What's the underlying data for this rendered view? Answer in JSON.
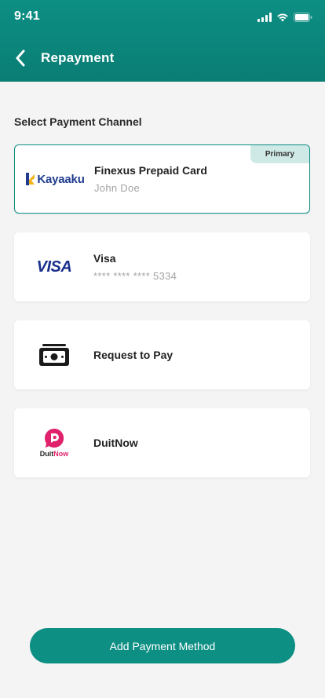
{
  "status_bar": {
    "time": "9:41"
  },
  "header": {
    "title": "Repayment",
    "back_icon": "chevron-left-icon"
  },
  "section_title": "Select Payment Channel",
  "channels": [
    {
      "logo": "Kayaaku",
      "title": "Finexus Prepaid Card",
      "subtitle": "John Doe",
      "badge": "Primary",
      "selected": true
    },
    {
      "logo": "VISA",
      "title": "Visa",
      "subtitle": "**** **** **** 5334",
      "selected": false
    },
    {
      "logo": "cash-icon",
      "title": "Request to Pay",
      "selected": false
    },
    {
      "logo_duit": "Duit",
      "logo_now": "Now",
      "title": "DuitNow",
      "selected": false
    }
  ],
  "add_button": {
    "label": "Add Payment Method"
  },
  "colors": {
    "primary": "#0d8f84",
    "badge_bg": "#cfe9e6",
    "visa_blue": "#1a2f8c",
    "duitnow_pink": "#e0216b",
    "kayaaku_yellow": "#f2b21a"
  }
}
